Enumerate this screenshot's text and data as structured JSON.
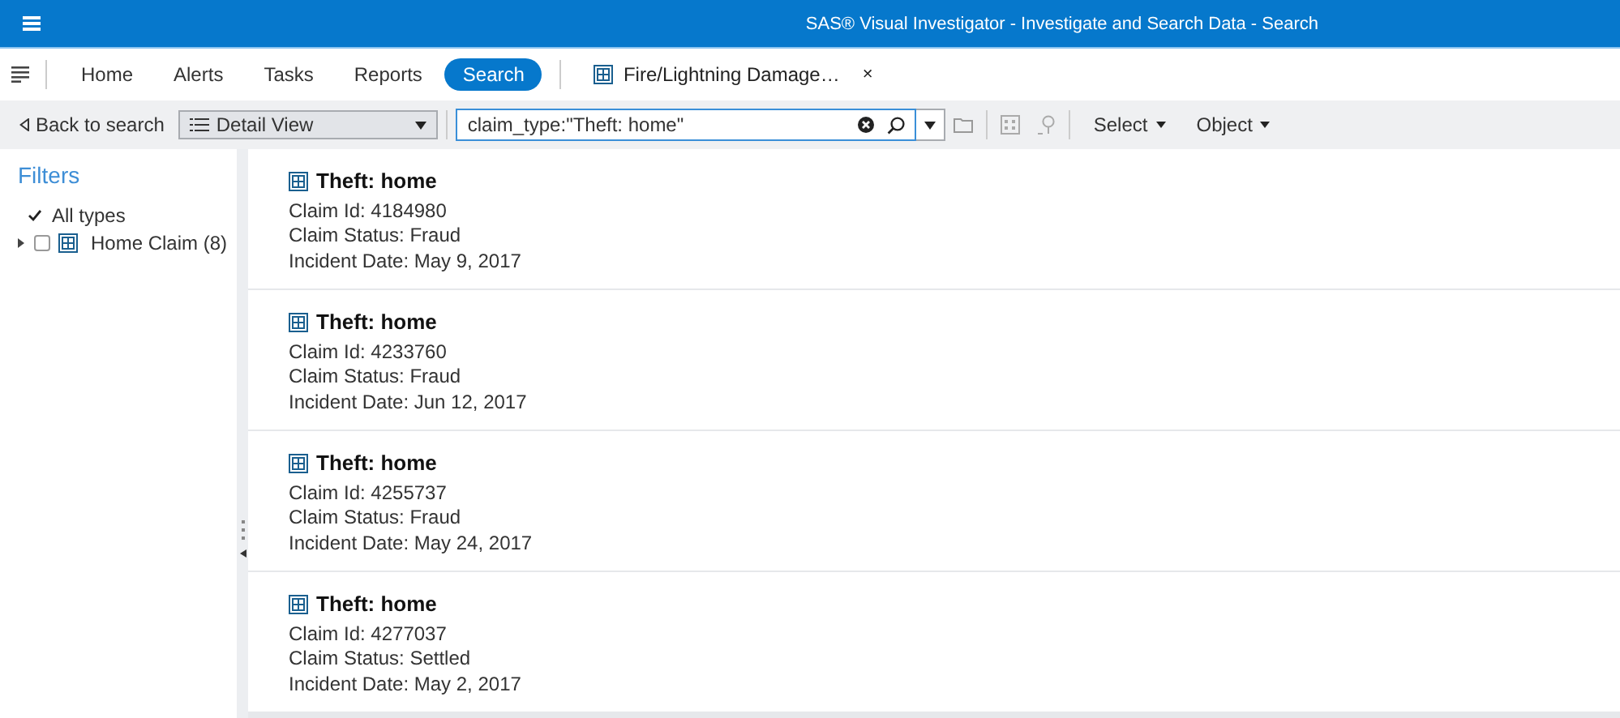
{
  "window": {
    "title": "SAS® Visual Investigator - Investigate and Search Data - Search"
  },
  "nav": {
    "tabs": [
      {
        "label": "Home",
        "selected": false
      },
      {
        "label": "Alerts",
        "selected": false
      },
      {
        "label": "Tasks",
        "selected": false
      },
      {
        "label": "Reports",
        "selected": false
      },
      {
        "label": "Search",
        "selected": true
      }
    ],
    "open_document": {
      "label": "Fire/Lightning Damage…",
      "close": "×"
    }
  },
  "toolbar": {
    "back": "Back to search",
    "view": "Detail View",
    "search": {
      "value": "claim_type:\"Theft: home\""
    },
    "menus": [
      "Select",
      "Object"
    ]
  },
  "filters": {
    "title": "Filters",
    "items": [
      {
        "kind": "all",
        "label": "All types",
        "checked": true
      },
      {
        "kind": "type",
        "label": "Home Claim (8)",
        "checked": false,
        "expanded": false
      }
    ]
  },
  "results": [
    {
      "title": "Theft: home",
      "fields": [
        "Claim Id: 4184980",
        "Claim Status: Fraud",
        "Incident Date: May 9, 2017"
      ]
    },
    {
      "title": "Theft: home",
      "fields": [
        "Claim Id: 4233760",
        "Claim Status: Fraud",
        "Incident Date: Jun 12, 2017"
      ]
    },
    {
      "title": "Theft: home",
      "fields": [
        "Claim Id: 4255737",
        "Claim Status: Fraud",
        "Incident Date: May 24, 2017"
      ]
    },
    {
      "title": "Theft: home",
      "fields": [
        "Claim Id: 4277037",
        "Claim Status: Settled",
        "Incident Date: May 2, 2017"
      ]
    }
  ]
}
